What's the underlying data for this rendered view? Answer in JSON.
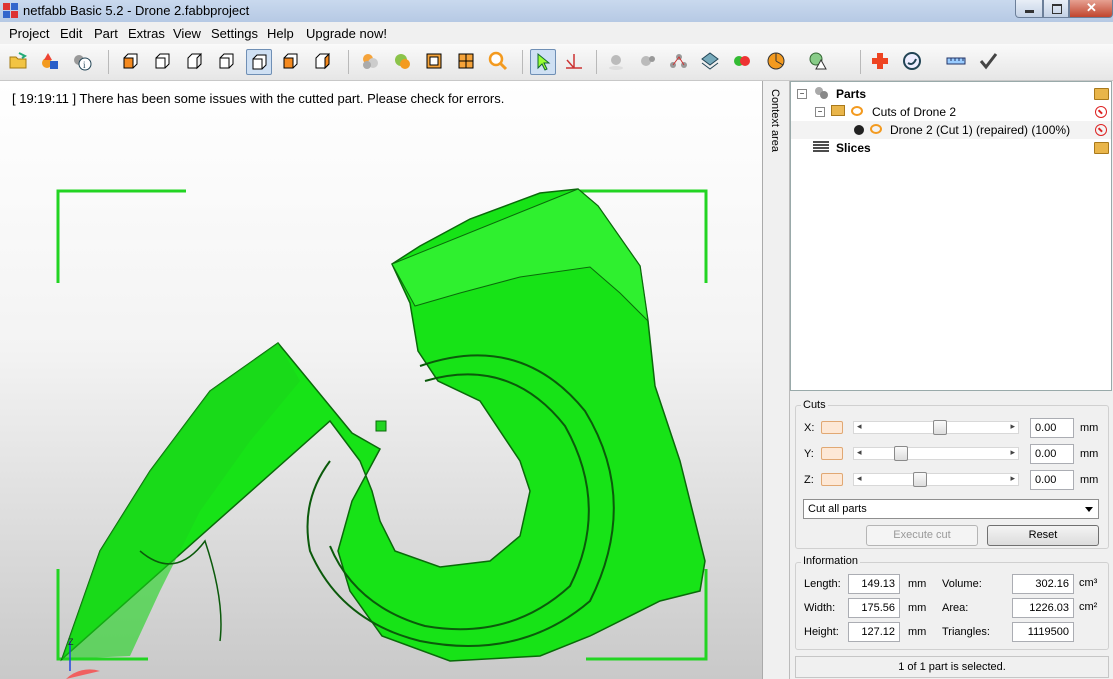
{
  "window": {
    "title": "netfabb Basic 5.2 - Drone 2.fabbproject"
  },
  "menu": [
    "Project",
    "Edit",
    "Part",
    "Extras",
    "View",
    "Settings",
    "Help",
    "Upgrade now!"
  ],
  "toolbar": {
    "icons": [
      "open-icon",
      "add-part-icon",
      "part-info-icon",
      "view-front-icon",
      "view-back-icon",
      "view-left-icon",
      "view-right-icon",
      "view-top-icon",
      "view-bottom-icon",
      "shaded-icon",
      "color-icon",
      "wireframe-icon",
      "mesh-icon",
      "zoom-icon",
      "select-icon",
      "measure-icon",
      "sphere-icon",
      "spheres-icon",
      "points-icon",
      "layers-icon",
      "colored-spheres-icon",
      "pie-icon",
      "warning-icon",
      "repair-icon",
      "quality-icon",
      "ruler-icon",
      "apply-icon"
    ]
  },
  "log": {
    "time": "[ 19:19:11 ]",
    "message": "There has been some issues with the cutted part. Please check for errors."
  },
  "context_label": "Context area",
  "tree": {
    "parts": "Parts",
    "group": "Cuts of Drone 2",
    "item": "Drone 2 (Cut 1) (repaired) (100%)",
    "slices": "Slices"
  },
  "cuts": {
    "title": "Cuts",
    "axes": [
      {
        "label": "X:",
        "value": "0.00",
        "unit": "mm",
        "position": 0.52
      },
      {
        "label": "Y:",
        "value": "0.00",
        "unit": "mm",
        "position": 0.22
      },
      {
        "label": "Z:",
        "value": "0.00",
        "unit": "mm",
        "position": 0.37
      }
    ],
    "mode": "Cut all parts",
    "execute": "Execute cut",
    "reset": "Reset"
  },
  "info": {
    "title": "Information",
    "length_label": "Length:",
    "length": "149.13",
    "length_unit": "mm",
    "width_label": "Width:",
    "width": "175.56",
    "width_unit": "mm",
    "height_label": "Height:",
    "height": "127.12",
    "height_unit": "mm",
    "volume_label": "Volume:",
    "volume": "302.16",
    "volume_unit": "cm³",
    "area_label": "Area:",
    "area": "1226.03",
    "area_unit": "cm²",
    "triangles_label": "Triangles:",
    "triangles": "1119500"
  },
  "status": "1 of 1 part is selected.",
  "colors": {
    "part": "#17e317",
    "bracket": "#22d422"
  },
  "axis_marker": "Z"
}
